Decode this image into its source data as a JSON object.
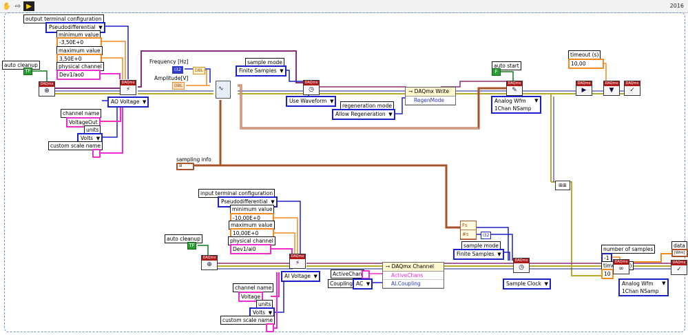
{
  "toolbar": {
    "year": "2016"
  },
  "ao": {
    "output_terminal_label": "output terminal configuration",
    "output_terminal_value": "Pseudodifferential",
    "minimum_label": "minimum value",
    "minimum_value": "-3,50E+0",
    "maximum_label": "maximum value",
    "maximum_value": "3,50E+0",
    "physical_label": "physical channel",
    "physical_value": "Dev1/ao0",
    "auto_cleanup_label": "auto cleanup",
    "auto_cleanup_value": "TF",
    "voltage_selector": "AO Voltage",
    "channel_name_label": "channel name",
    "channel_name_value": "VoltageOut",
    "units_label": "units",
    "units_value": "Volts",
    "custom_scale_label": "custom scale name"
  },
  "gen": {
    "frequency_label": "Frequency [Hz]",
    "frequency_type": "I32",
    "amplitude_label": "Amplitude[V]",
    "amplitude_type": "DBL",
    "dbl_tag": "DBL",
    "sampling_info_label": "sampling info"
  },
  "write": {
    "sample_mode_label": "sample mode",
    "sample_mode_value": "Finite Samples",
    "use_waveform": "Use Waveform",
    "regeneration_label": "regeneration mode",
    "regeneration_value": "Allow Regeneration",
    "node_title": "DAQmx Write",
    "node_prop": "RegenMode",
    "auto_start_label": "auto start",
    "auto_start_value": "F",
    "analog_wfm": "Analog Wfm\n1Chan NSamp",
    "timeout_label": "timeout (s)",
    "timeout_value": "10,00"
  },
  "ai": {
    "input_terminal_label": "input terminal configuration",
    "input_terminal_value": "Pseudodifferential",
    "minimum_label": "minimum value",
    "minimum_value": "-10,00E+0",
    "maximum_label": "maximum value",
    "maximum_value": "10,00E+0",
    "physical_label": "physical channel",
    "physical_value": "Dev1/ai0",
    "auto_cleanup_label": "auto cleanup",
    "auto_cleanup_value": "TF",
    "voltage_selector": "AI Voltage",
    "channel_name_label": "channel name",
    "channel_name_value": "Voltage",
    "units_label": "units",
    "units_value": "Volts",
    "custom_scale_label": "custom scale name",
    "active_chan_label": "ActiveChan",
    "coupling_label": "Coupling",
    "coupling_value": "AC",
    "node_title": "DAQmx Channel",
    "node_prop1": "ActiveChans",
    "node_prop2": "AI.Coupling",
    "bundle_fs": "Fs",
    "bundle_ns": "#s",
    "i32_tag": "I32",
    "sample_mode_label": "sample mode",
    "sample_mode_value": "Finite Samples",
    "sample_clock": "Sample Clock",
    "num_samples_label": "number of samples",
    "num_samples_value": "-1",
    "timeout_label": "timeout (s)",
    "timeout_value": "10",
    "analog_wfm": "Analog Wfm\n1Chan NSamp",
    "data_label": "data",
    "data_type": "[Wfm]"
  }
}
